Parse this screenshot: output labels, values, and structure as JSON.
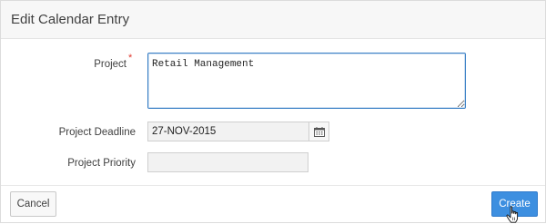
{
  "dialog": {
    "title": "Edit Calendar Entry"
  },
  "form": {
    "project": {
      "label": "Project",
      "required_marker": "*",
      "value": "Retail Management"
    },
    "deadline": {
      "label": "Project Deadline",
      "value": "27-NOV-2015"
    },
    "priority": {
      "label": "Project Priority",
      "value": ""
    }
  },
  "footer": {
    "cancel_label": "Cancel",
    "create_label": "Create"
  },
  "icons": {
    "calendar": "calendar-icon",
    "cursor": "hand-pointer-icon"
  },
  "colors": {
    "primary": "#3d8fe0",
    "focus_border": "#3c81c6",
    "required": "#e0392f"
  }
}
